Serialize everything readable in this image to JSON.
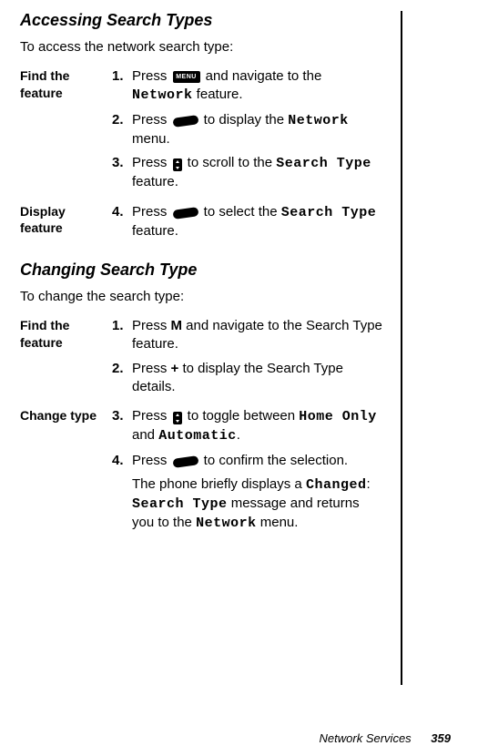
{
  "section1": {
    "heading": "Accessing Search Types",
    "intro": "To access the network search type:",
    "phases": [
      {
        "label": "Find the feature",
        "steps": [
          {
            "num": "1.",
            "pre": "Press ",
            "icon": "menu",
            "post": " and navigate to the ",
            "mono": "Network",
            "tail": " feature."
          },
          {
            "num": "2.",
            "pre": "Press ",
            "icon": "pill",
            "post": " to display the ",
            "mono": "Network",
            "tail": " menu."
          },
          {
            "num": "3.",
            "pre": "Press ",
            "icon": "scroll",
            "post": " to scroll to the ",
            "mono": "Search Type",
            "tail": " feature."
          }
        ]
      },
      {
        "label": "Display feature",
        "steps": [
          {
            "num": "4.",
            "pre": "Press ",
            "icon": "pill",
            "post": " to select the ",
            "mono": "Search Type",
            "tail": " feature."
          }
        ]
      }
    ]
  },
  "section2": {
    "heading": "Changing Search Type",
    "intro": "To change the search type:",
    "phases": [
      {
        "label": "Find the feature",
        "steps": [
          {
            "num": "1.",
            "pre": "Press  ",
            "icon": "m",
            "post": " and navigate to the Search Type feature."
          },
          {
            "num": "2.",
            "pre": "Press ",
            "icon": "plus",
            "post": " to display the Search Type details."
          }
        ]
      },
      {
        "label": "Change type",
        "steps": [
          {
            "num": "3.",
            "pre": "Press ",
            "icon": "scroll",
            "post": " to toggle between ",
            "mono": "Home Only",
            "mid": " and ",
            "mono2": "Automatic",
            "tail": "."
          },
          {
            "num": "4.",
            "pre": "Press ",
            "icon": "pill",
            "post": " to confirm the selection."
          }
        ],
        "extra": {
          "t1": "The phone briefly displays a ",
          "m1": "Changed",
          "t2": ": ",
          "m2": "Search Type",
          "t3": " message and returns you to the ",
          "m3": "Network",
          "t4": " menu."
        }
      }
    ]
  },
  "footer": {
    "section": "Network Services",
    "page": "359"
  },
  "icons": {
    "menu_label": "MENU"
  }
}
